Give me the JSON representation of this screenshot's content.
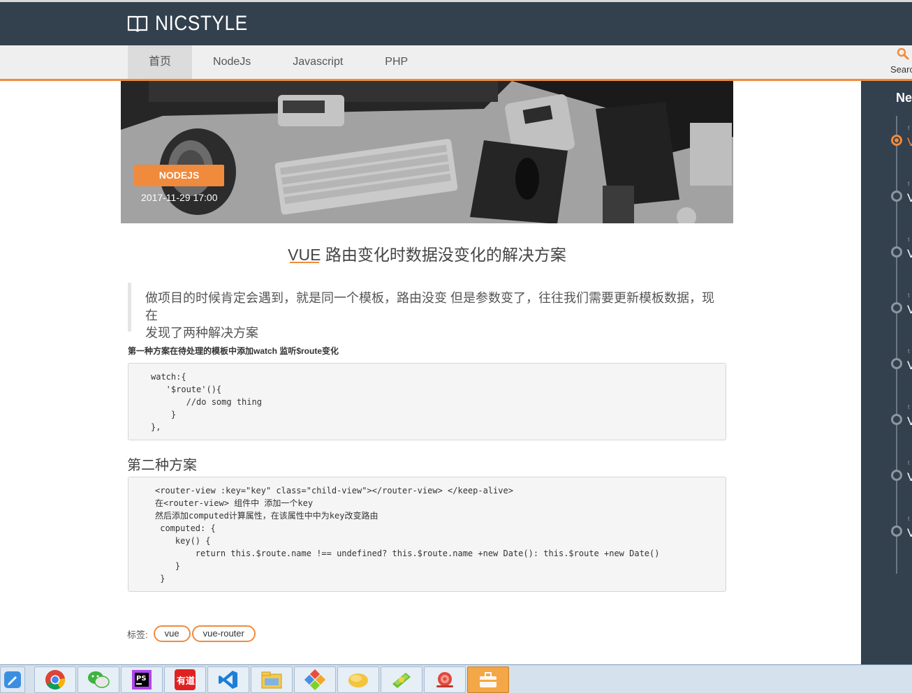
{
  "site": {
    "name": "NICSTYLE"
  },
  "nav": {
    "tabs": [
      {
        "label": "首页",
        "active": true
      },
      {
        "label": "NodeJs",
        "active": false
      },
      {
        "label": "Javascript",
        "active": false
      },
      {
        "label": "PHP",
        "active": false
      }
    ],
    "search_label": "Searc"
  },
  "hero": {
    "category": "NODEJS",
    "date": "2017-11-29 17:00"
  },
  "article": {
    "title": "VUE 路由变化时数据没变化的解决方案",
    "quote_line1": "做项目的时候肯定会遇到，就是同一个模板，路由没变 但是参数变了，往往我们需要更新模板数据，现在",
    "quote_line2": "发现了两种解决方案",
    "heading1": "第一种方案在待处理的模板中添加watch 监听$route变化",
    "code1": [
      "watch:{",
      "   '$route'(){",
      "       //do somg thing",
      "    }",
      "},"
    ],
    "heading2": "第二种方案",
    "code2": [
      "<router-view :key=\"key\" class=\"child-view\"></router-view> </keep-alive>",
      "在<router-view> 组件中 添加一个key",
      "然后添加computed计算属性，在该属性中中为key改变路由",
      " computed: {",
      "    key() {",
      "        return this.$route.name !== undefined? this.$route.name +new Date(): this.$route +new Date()",
      "    }",
      " }"
    ],
    "tags_label": "标签:",
    "tags": [
      "vue",
      "vue-router"
    ]
  },
  "sidebar": {
    "title": "Ne",
    "items": [
      {
        "meta": "t",
        "text": "V",
        "active": true
      },
      {
        "meta": "t",
        "text": "V",
        "active": false
      },
      {
        "meta": "t",
        "text": "V",
        "active": false
      },
      {
        "meta": "t",
        "text": "V",
        "active": false
      },
      {
        "meta": "t",
        "text": "V",
        "active": false
      },
      {
        "meta": "t",
        "text": "V",
        "active": false
      },
      {
        "meta": "t",
        "text": "V",
        "active": false
      },
      {
        "meta": "t",
        "text": "V",
        "active": false
      }
    ]
  },
  "taskbar": {
    "apps": [
      "start-icon",
      "chrome-icon",
      "wechat-icon",
      "phpstorm-icon",
      "youdao-icon",
      "vscode-icon",
      "file-manager-icon",
      "git-icon",
      "folder-icon",
      "money-icon",
      "snail-icon",
      "toolbox-icon"
    ]
  },
  "colors": {
    "accent": "#f08a3c",
    "header_bg": "#33404e",
    "nav_bg": "#efefef"
  }
}
